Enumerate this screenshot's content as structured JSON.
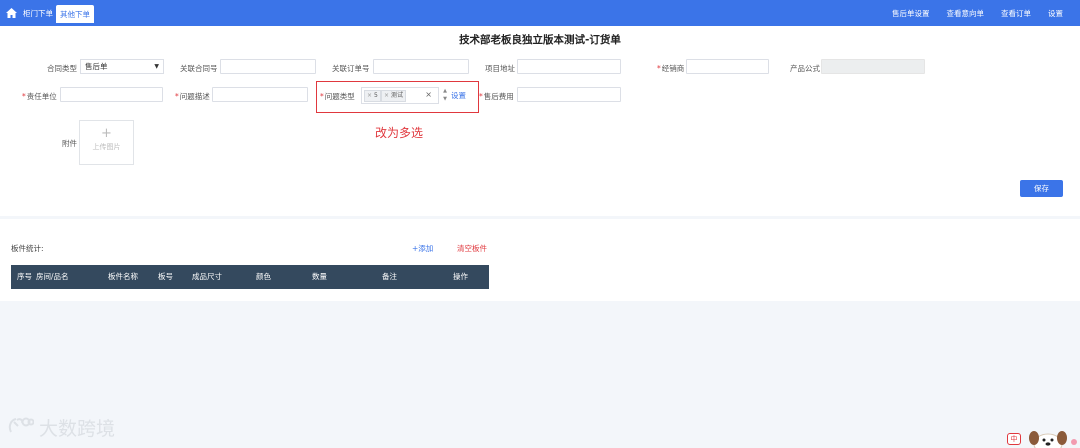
{
  "topbar": {
    "tabs": [
      {
        "label": "柜门下单",
        "active": false
      },
      {
        "label": "其他下单",
        "active": true
      }
    ],
    "right_links": [
      "售后单设置",
      "查看意向单",
      "查看订单",
      "设置"
    ]
  },
  "form": {
    "title": "技术部老板良独立版本测试-订货单",
    "contract_type_label": "合同类型",
    "contract_type_value": "售后单",
    "related_contract_label": "关联合同号",
    "related_order_label": "关联订单号",
    "project_address_label": "项目地址",
    "dealer_label": "经销商",
    "product_formula_label": "产品公式",
    "responsible_unit_label": "责任单位",
    "problem_desc_label": "问题描述",
    "problem_type_label": "问题类型",
    "problem_type_chips": [
      "5",
      "测试"
    ],
    "problem_type_clear": "×",
    "problem_type_setting": "设置",
    "aftersale_fee_label": "售后费用",
    "attachment_label": "附件",
    "upload_plus": "+",
    "upload_label": "上传图片",
    "annotation_note": "改为多选",
    "save_label": "保存"
  },
  "panel": {
    "stat_label": "板件统计:",
    "add_label": "+添加",
    "clear_label": "清空板件",
    "columns": [
      "序号",
      "房间/品名",
      "板件名称",
      "板号",
      "成品尺寸",
      "颜色",
      "数量",
      "备注",
      "操作"
    ]
  },
  "watermark": {
    "text": "大数跨境"
  },
  "ime": {
    "label": "中"
  },
  "colors": {
    "primary": "#3b74e8",
    "danger": "#e0383e",
    "table_header": "#34495e"
  }
}
